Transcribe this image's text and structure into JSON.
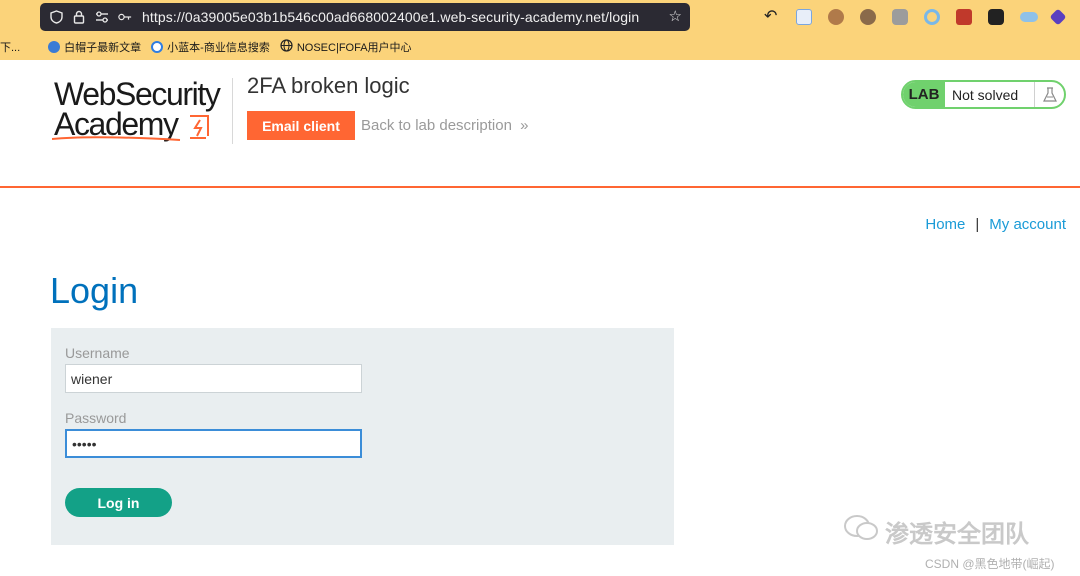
{
  "browser": {
    "url": "https://0a39005e03b1b546c00ad668002400e1.web-security-academy.net/login",
    "bookmarks": [
      {
        "label": "下...",
        "icon": "folder-icon"
      },
      {
        "label": "白帽子最新文章",
        "icon": "bookmark-icon"
      },
      {
        "label": "小蓝本-商业信息搜索",
        "icon": "bookmark-icon"
      },
      {
        "label": "NOSEC|FOFA用户中心",
        "icon": "globe-icon"
      }
    ]
  },
  "header": {
    "logo_line1": "WebSecurity",
    "logo_line2": "Academy",
    "lab_title": "2FA broken logic",
    "email_client": "Email client",
    "back_link": "Back to lab description",
    "status_tag": "LAB",
    "status_text": "Not solved"
  },
  "nav": {
    "home": "Home",
    "separator": "|",
    "my_account": "My account"
  },
  "login": {
    "heading": "Login",
    "username_label": "Username",
    "username_value": "wiener",
    "password_label": "Password",
    "password_value": "peter",
    "submit": "Log in"
  },
  "watermark": {
    "text": "渗透安全团队",
    "credit": "CSDN @黑色地带(崛起)"
  },
  "colors": {
    "accent": "#ff6633",
    "link": "#1a9bd7",
    "heading": "#0071bc",
    "button": "#13a187",
    "status": "#70d16d"
  }
}
